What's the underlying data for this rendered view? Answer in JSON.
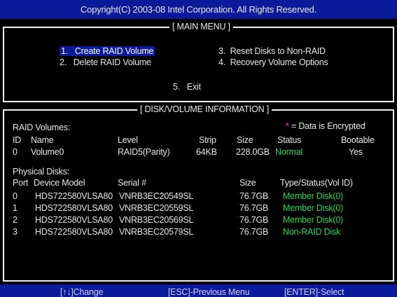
{
  "header": {
    "copyright": "Copyright(C) 2003-08 Intel Corporation.  All Rights Reserved."
  },
  "main_menu": {
    "title": "[ MAIN MENU ]",
    "items": [
      {
        "num": "1.",
        "label": "Create RAID Volume"
      },
      {
        "num": "2.",
        "label": "Delete RAID Volume"
      },
      {
        "num": "3.",
        "label": "Reset Disks to Non-RAID"
      },
      {
        "num": "4.",
        "label": "Recovery Volume Options"
      },
      {
        "num": "5.",
        "label": "Exit"
      }
    ]
  },
  "info": {
    "title": "[ DISK/VOLUME INFORMATION ]",
    "encrypted_note": {
      "symbol": "*",
      "text": "= Data is Encrypted"
    },
    "raid_volumes_label": "RAID Volumes:",
    "volume_headers": [
      "ID",
      "Name",
      "Level",
      "Strip",
      "Size",
      "Status",
      "Bootable"
    ],
    "volumes": [
      [
        "0",
        "Volume0",
        "RAID5(Parity)",
        "64KB",
        "228.0GB",
        "Normal",
        "Yes"
      ]
    ],
    "physical_disks_label": "Physical Disks:",
    "disk_headers": [
      "Port",
      "Device Model",
      "Serial #",
      "Size",
      "Type/Status(Vol ID)"
    ],
    "disks": [
      [
        "0",
        "HDS722580VLSA80",
        "VNRB3EC20549SL",
        "76.7GB",
        "Member Disk(0)"
      ],
      [
        "1",
        "HDS722580VLSA80",
        "VNRB3EC20559SL",
        "76.7GB",
        "Member Disk(0)"
      ],
      [
        "2",
        "HDS722580VLSA80",
        "VNRB3EC20569SL",
        "76.7GB",
        "Member Disk(0)"
      ],
      [
        "3",
        "HDS722580VLSA80",
        "VNRB3EC20579SL",
        "76.7GB",
        "Non-RAID Disk"
      ]
    ]
  },
  "footer": {
    "change": "[↑↓]Change",
    "previous": "[ESC]-Previous Menu",
    "select": "[ENTER]-Select"
  },
  "colors": {
    "bar_blue": "#0a1a9b",
    "status_green": "#27d94c",
    "encrypted_magenta": "#ff35ff"
  }
}
